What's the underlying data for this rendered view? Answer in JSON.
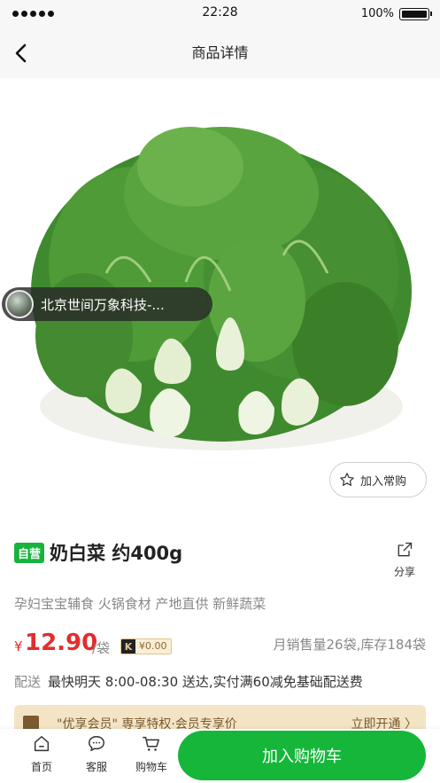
{
  "status_bar": {
    "time": "22:28",
    "battery": "100%"
  },
  "nav": {
    "title": "商品详情"
  },
  "image": {
    "seller_name": "北京世间万象科技-..."
  },
  "favorite": {
    "label": "加入常购"
  },
  "product": {
    "tag": "自营",
    "title": "奶白菜 约400g",
    "share_label": "分享",
    "tags_line": "孕妇宝宝辅食 火锅食材 产地直供 新鲜蔬菜",
    "currency": "¥",
    "price": "12.90",
    "unit": "/袋",
    "coin_value": "¥0.00",
    "sales_info": "月销售量26袋,库存184袋",
    "delivery_label": "配送",
    "delivery_text": "最快明天 8:00-08:30 送达,实付满60减免基础配送费"
  },
  "member_banner": {
    "text": "\"优享会员\" 専享特权·会员专享价",
    "action": "立即开通 〉"
  },
  "bottom_bar": {
    "tabs": [
      {
        "label": "首页",
        "icon": "home-icon"
      },
      {
        "label": "客服",
        "icon": "chat-icon"
      },
      {
        "label": "购物车",
        "icon": "cart-icon"
      }
    ],
    "add_to_cart": "加入购物车"
  },
  "colors": {
    "brand_green": "#16b63b",
    "price_red": "#e32d2d",
    "member_gold": "#f3e4c6"
  }
}
